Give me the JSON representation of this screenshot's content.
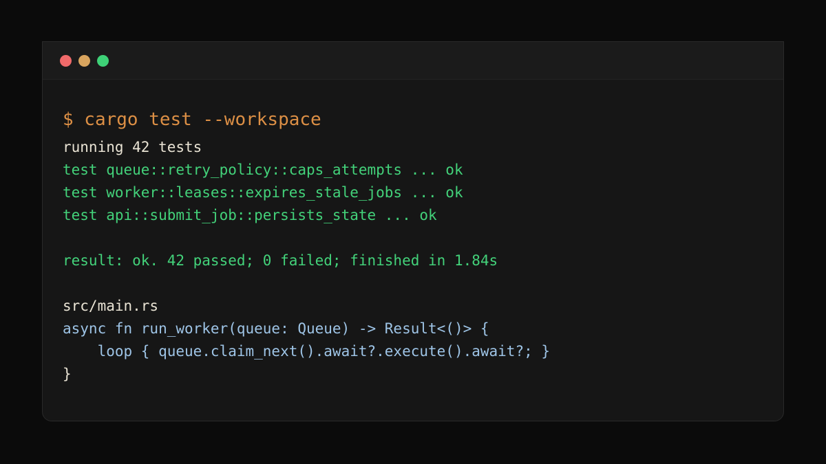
{
  "window": {
    "controls": [
      {
        "name": "close",
        "color": "#f06a6a"
      },
      {
        "name": "minimize",
        "color": "#d9a55f"
      },
      {
        "name": "zoom",
        "color": "#3ed177"
      }
    ]
  },
  "colors": {
    "command": "#dc8f45",
    "plain": "#e9e3d4",
    "success": "#43d27a",
    "code": "#9ec4e6"
  },
  "terminal": {
    "command": "$ cargo test --workspace",
    "running": "running 42 tests",
    "tests": [
      "test queue::retry_policy::caps_attempts ... ok",
      "test worker::leases::expires_stale_jobs ... ok",
      "test api::submit_job::persists_state ... ok"
    ],
    "result": "result: ok. 42 passed; 0 failed; finished in 1.84s",
    "file_name": "src/main.rs",
    "code_lines": [
      "async fn run_worker(queue: Queue) -> Result<()> {",
      "    loop { queue.claim_next().await?.execute().await?; }"
    ],
    "closing_brace": "}"
  }
}
